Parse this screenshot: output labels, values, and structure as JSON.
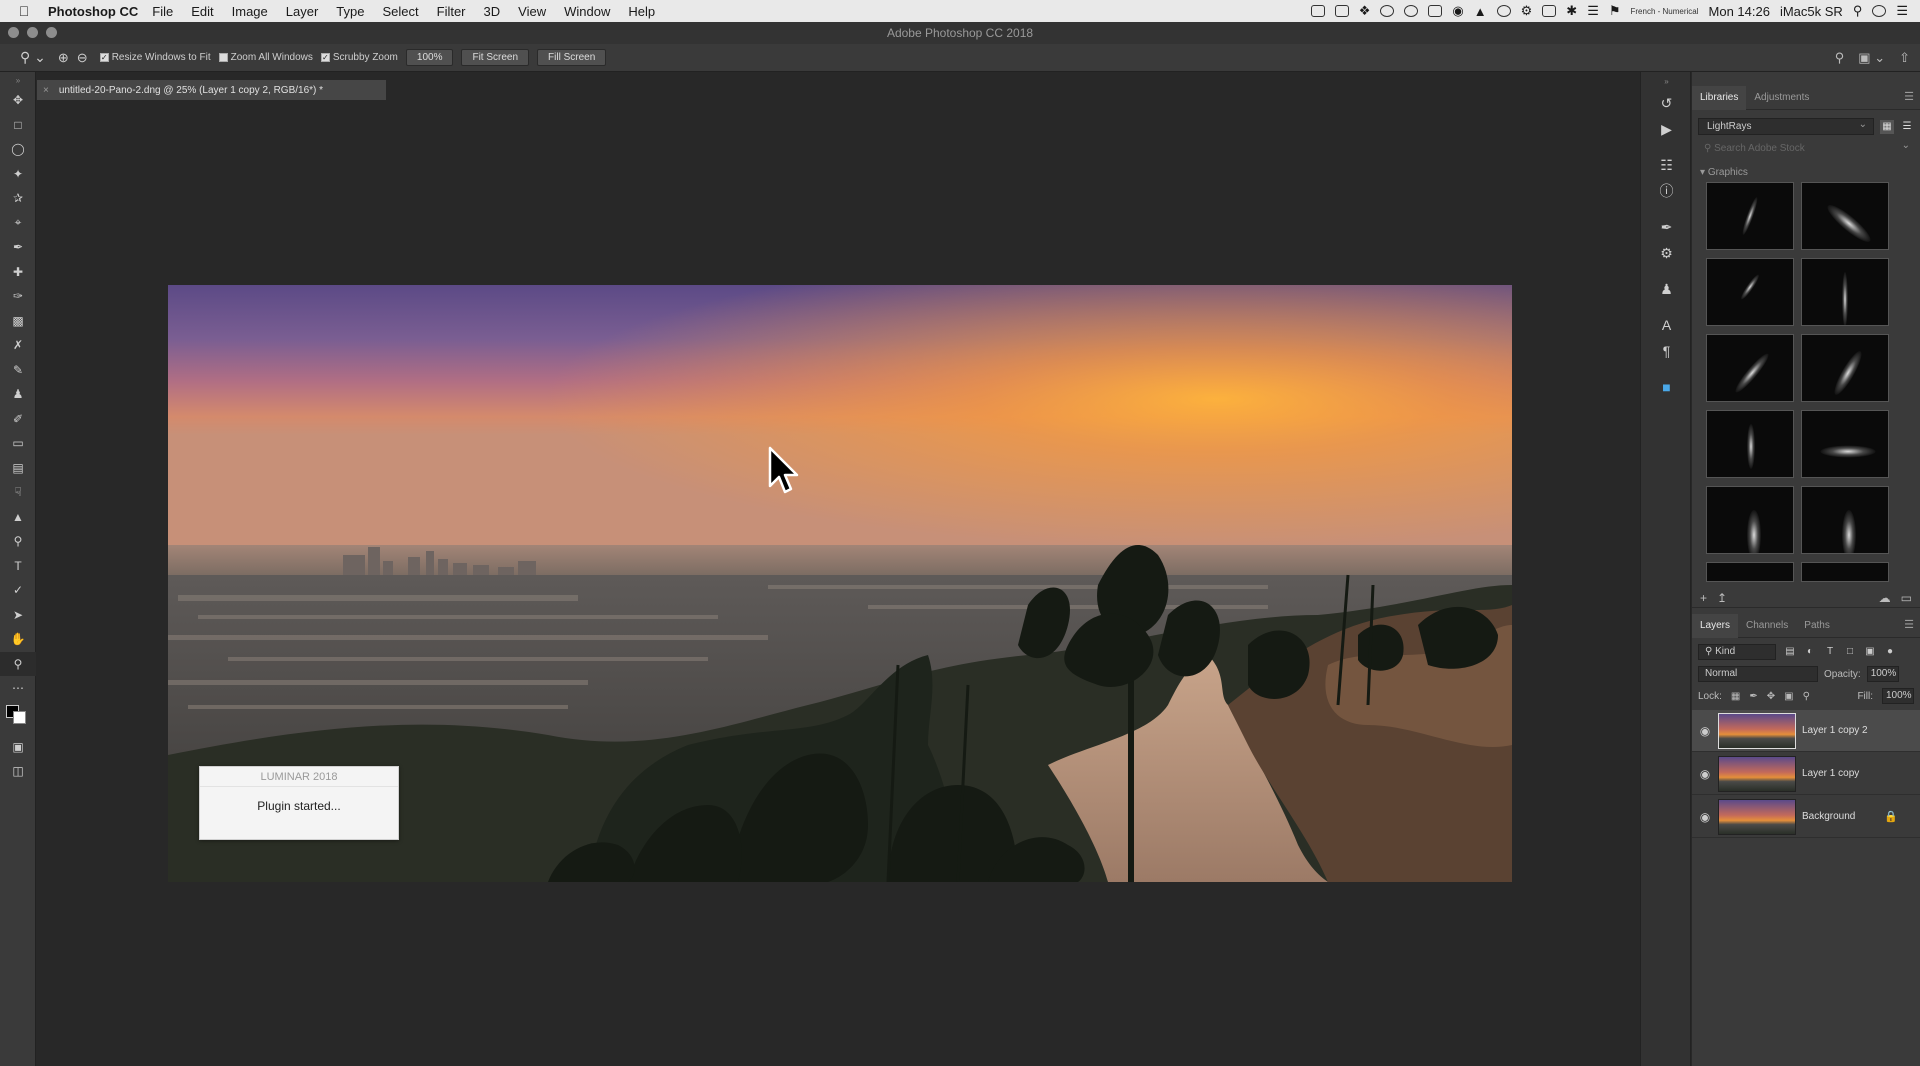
{
  "menubar": {
    "apple": "",
    "app_name": "Photoshop CC",
    "menus": [
      "File",
      "Edit",
      "Image",
      "Layer",
      "Type",
      "Select",
      "Filter",
      "3D",
      "View",
      "Window",
      "Help"
    ],
    "input_source": "French - Numerical",
    "clock": "Mon 14:26",
    "user": "iMac5k SR"
  },
  "window": {
    "title": "Adobe Photoshop CC 2018"
  },
  "options_bar": {
    "resize_windows": "Resize Windows to Fit",
    "zoom_all": "Zoom All Windows",
    "scrubby_zoom": "Scrubby Zoom",
    "zoom_value": "100%",
    "fit_screen": "Fit Screen",
    "fill_screen": "Fill Screen"
  },
  "document_tab": {
    "title": "untitled-20-Pano-2.dng @ 25% (Layer 1 copy 2, RGB/16*) *"
  },
  "dialog": {
    "title": "LUMINAR 2018",
    "message": "Plugin started..."
  },
  "libraries": {
    "tabs": [
      "Libraries",
      "Adjustments"
    ],
    "selected_library": "LightRays",
    "search_placeholder": "Search Adobe Stock",
    "section": "Graphics"
  },
  "layers_panel": {
    "tabs": [
      "Layers",
      "Channels",
      "Paths"
    ],
    "filter_kind": "Kind",
    "blend_mode": "Normal",
    "opacity_label": "Opacity:",
    "opacity_value": "100%",
    "lock_label": "Lock:",
    "fill_label": "Fill:",
    "fill_value": "100%",
    "layers": [
      {
        "name": "Layer 1 copy 2",
        "active": true
      },
      {
        "name": "Layer 1 copy",
        "active": false
      },
      {
        "name": "Background",
        "active": false,
        "locked": true
      }
    ]
  },
  "colors": {
    "menubar_bg": "#e9e9e9",
    "panel_bg": "#3a3a3a",
    "canvas_bg": "#282828",
    "dialog_bg": "#f4f4f4"
  }
}
